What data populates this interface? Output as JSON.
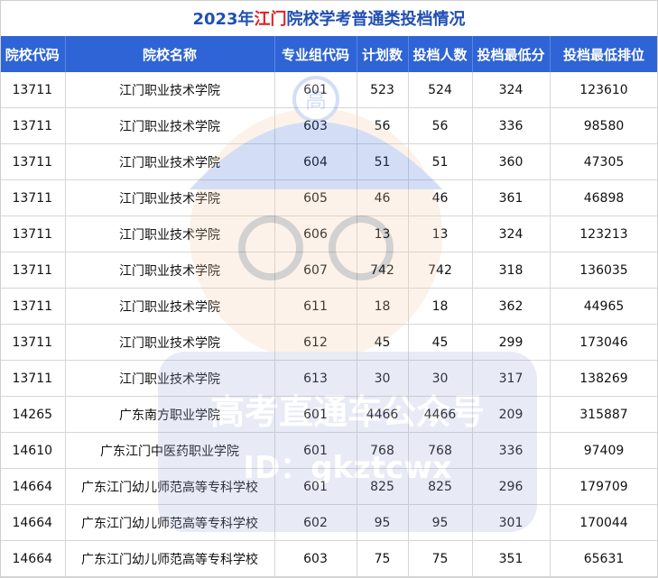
{
  "title": {
    "prefix": "2023年",
    "highlight": "江门",
    "suffix": "院校学考普通类投档情况"
  },
  "watermark": {
    "line1": "高考直通车公众号",
    "line2": "ID：gkztcwx",
    "badge": "高"
  },
  "colors": {
    "header_bg": "#2f64d6",
    "title_blue": "#1f4fb4",
    "title_red": "#e02020"
  },
  "table": {
    "headers": [
      "院校代码",
      "院校名称",
      "专业组代码",
      "计划数",
      "投档人数",
      "投档最低分",
      "投档最低排位"
    ],
    "rows": [
      [
        "13711",
        "江门职业技术学院",
        "601",
        "523",
        "524",
        "324",
        "123610"
      ],
      [
        "13711",
        "江门职业技术学院",
        "603",
        "56",
        "56",
        "336",
        "98580"
      ],
      [
        "13711",
        "江门职业技术学院",
        "604",
        "51",
        "51",
        "360",
        "47305"
      ],
      [
        "13711",
        "江门职业技术学院",
        "605",
        "46",
        "46",
        "361",
        "46898"
      ],
      [
        "13711",
        "江门职业技术学院",
        "606",
        "13",
        "13",
        "324",
        "123213"
      ],
      [
        "13711",
        "江门职业技术学院",
        "607",
        "742",
        "742",
        "318",
        "136035"
      ],
      [
        "13711",
        "江门职业技术学院",
        "611",
        "18",
        "18",
        "362",
        "44965"
      ],
      [
        "13711",
        "江门职业技术学院",
        "612",
        "45",
        "45",
        "299",
        "173046"
      ],
      [
        "13711",
        "江门职业技术学院",
        "613",
        "30",
        "30",
        "317",
        "138269"
      ],
      [
        "14265",
        "广东南方职业学院",
        "601",
        "4466",
        "4466",
        "209",
        "315887"
      ],
      [
        "14610",
        "广东江门中医药职业学院",
        "601",
        "768",
        "768",
        "336",
        "97409"
      ],
      [
        "14664",
        "广东江门幼儿师范高等专科学校",
        "601",
        "825",
        "825",
        "296",
        "179709"
      ],
      [
        "14664",
        "广东江门幼儿师范高等专科学校",
        "602",
        "95",
        "95",
        "301",
        "170044"
      ],
      [
        "14664",
        "广东江门幼儿师范高等专科学校",
        "603",
        "75",
        "75",
        "351",
        "65631"
      ]
    ]
  }
}
